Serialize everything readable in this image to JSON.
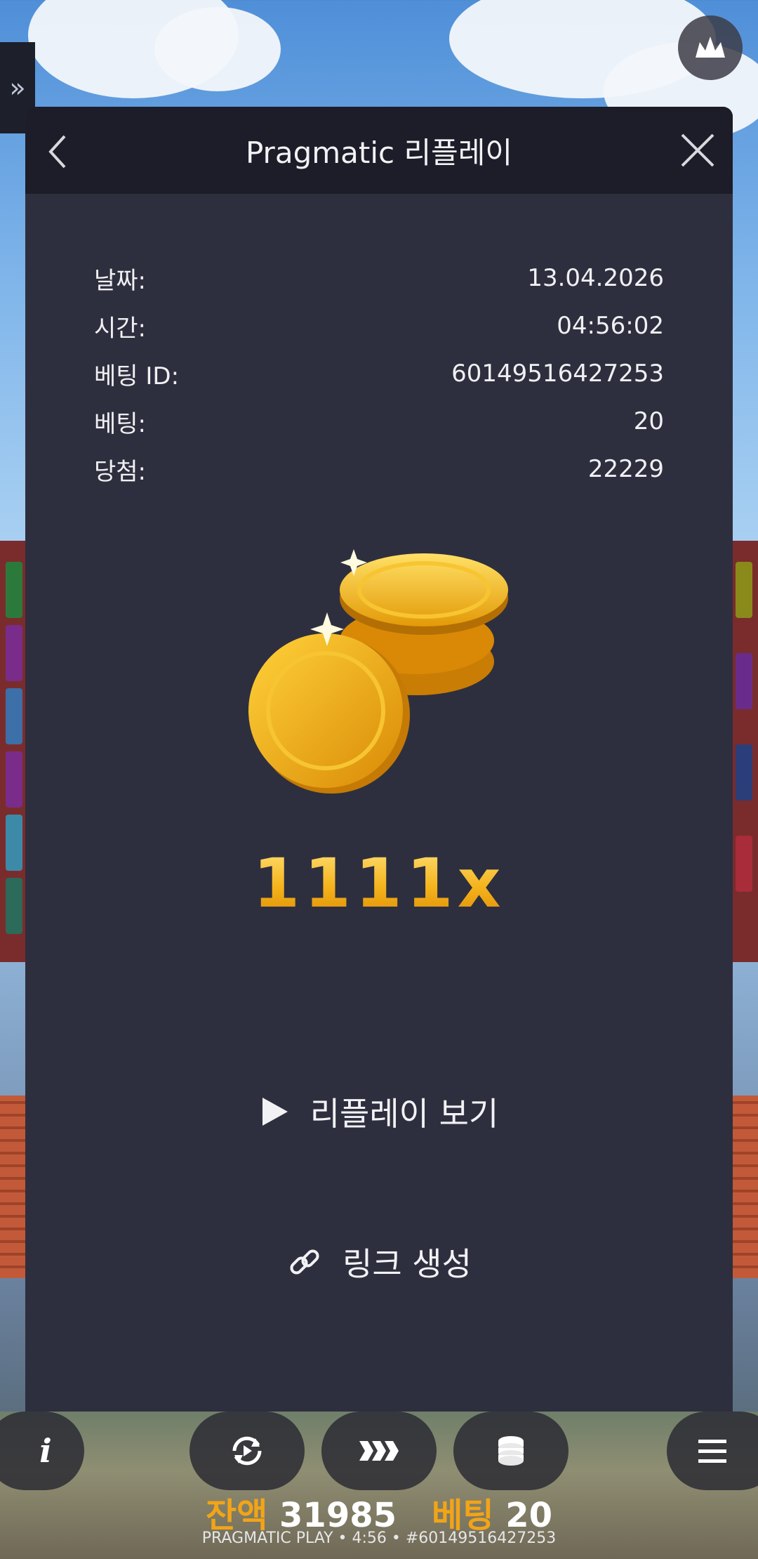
{
  "header": {
    "title": "Pragmatic 리플레이"
  },
  "info": {
    "date_label": "날짜:",
    "date_value": "13.04.2026",
    "time_label": "시간:",
    "time_value": "04:56:02",
    "bet_id_label": "베팅 ID:",
    "bet_id_value": "60149516427253",
    "bet_label": "베팅:",
    "bet_value": "20",
    "win_label": "당첨:",
    "win_value": "22229"
  },
  "multiplier": "1111x",
  "actions": {
    "watch_replay": "리플레이 보기",
    "create_link": "링크 생성"
  },
  "status": {
    "balance_label": "잔액",
    "balance_value": "31985",
    "bet_label": "베팅",
    "bet_value": "20"
  },
  "footer": "PRAGMATIC PLAY • 4:56 • #60149516427253",
  "colors": {
    "modal_bg": "#2e2f3e",
    "header_bg": "#1c1d28",
    "accent_gold": "#f2a418"
  },
  "icons": [
    "double-chevron-right-icon",
    "crown-icon",
    "back-chevron-icon",
    "close-icon",
    "coin-stack-icon",
    "play-icon",
    "link-icon",
    "info-icon",
    "autoplay-icon",
    "turbo-icon",
    "coins-bet-icon",
    "menu-icon"
  ]
}
